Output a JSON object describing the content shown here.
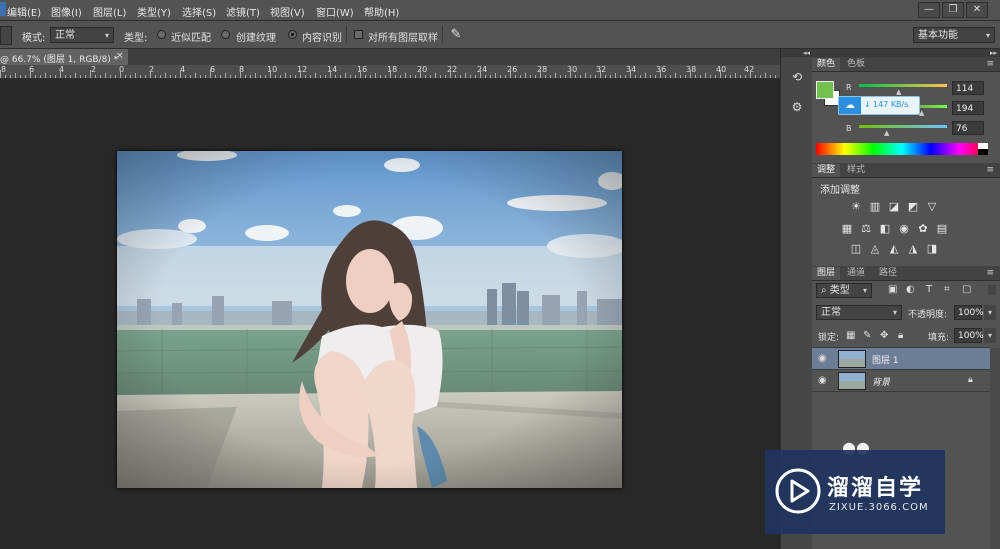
{
  "menu": {
    "items": [
      "编辑(E)",
      "图像(I)",
      "图层(L)",
      "类型(Y)",
      "选择(S)",
      "滤镜(T)",
      "视图(V)",
      "窗口(W)",
      "帮助(H)"
    ],
    "window_controls": [
      "—",
      "❐",
      "✕"
    ]
  },
  "options_bar": {
    "mode_label": "模式:",
    "mode_value": "正常",
    "type_label": "类型:",
    "radio_1": "近似匹配",
    "radio_2": "创建纹理",
    "radio_3": "内容识别",
    "checkbox_label": "对所有图层取样",
    "workspace": "基本功能"
  },
  "document": {
    "tab_label": "@ 66.7% (图层 1, RGB/8) *",
    "close": "×"
  },
  "ruler": {
    "labels": [
      "8",
      "6",
      "4",
      "2",
      "0",
      "2",
      "4",
      "6",
      "8",
      "10",
      "12",
      "14",
      "16",
      "18",
      "20",
      "22",
      "24",
      "26",
      "28",
      "30",
      "32",
      "34",
      "36",
      "38",
      "40",
      "42"
    ]
  },
  "color_panel": {
    "tabs": [
      "颜色",
      "色板"
    ],
    "r_label": "R",
    "g_label": "G",
    "b_label": "B",
    "r_value": "114",
    "g_value": "194",
    "b_value": "76",
    "fg_color": "#72c24c",
    "download_badge": "147 KB/s",
    "r": 114,
    "g": 194,
    "b": 76
  },
  "adjustments_panel": {
    "tabs": [
      "调整",
      "样式"
    ],
    "add_label": "添加调整"
  },
  "layers_panel": {
    "tabs": [
      "图层",
      "通道",
      "路径"
    ],
    "filter_label": "类型",
    "blend_mode": "正常",
    "opacity_label": "不透明度:",
    "opacity_value": "100%",
    "lock_label": "锁定:",
    "fill_label": "填充:",
    "fill_value": "100%",
    "layers": [
      {
        "name": "图层 1",
        "selected": true
      },
      {
        "name": "背景",
        "selected": false
      }
    ]
  },
  "watermark": {
    "title": "溜溜自学",
    "url": "ZIXUE.3066.COM"
  }
}
